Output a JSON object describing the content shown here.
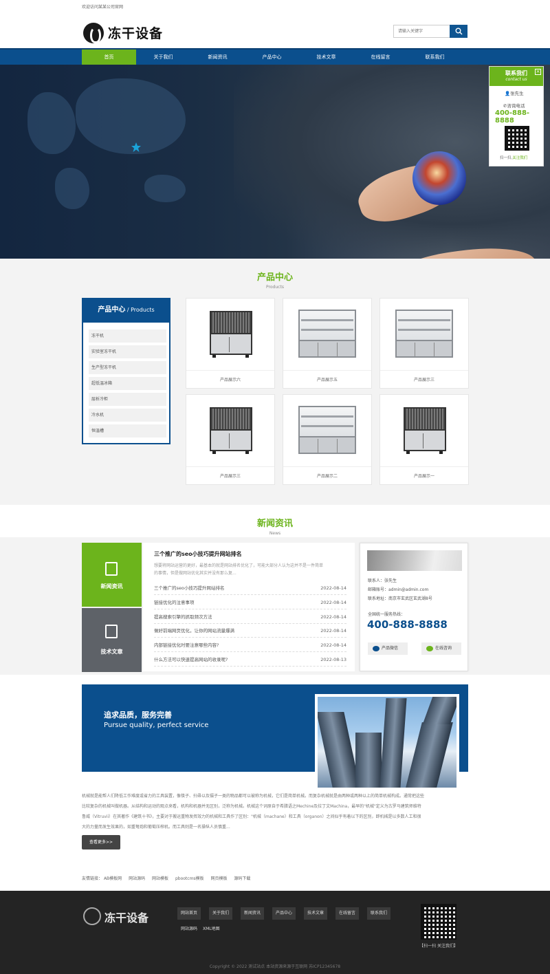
{
  "topbar": {
    "welcome": "欢迎访问某某公司官网"
  },
  "header": {
    "logo_text": "冻干设备",
    "search_placeholder": "请输入关键字"
  },
  "nav": {
    "items": [
      "首页",
      "关于我们",
      "新闻资讯",
      "产品中心",
      "技术文章",
      "在线留言",
      "联系我们"
    ],
    "active_index": 0
  },
  "float_contact": {
    "title": "联系我们",
    "subtitle": "contact us",
    "person": "张先生",
    "phone_label": "咨询电话",
    "phone": "400-888-8888",
    "scan_prefix": "扫一扫,",
    "scan_action": "关注我们"
  },
  "products": {
    "title": "产品中心",
    "title_en": "Products",
    "sidebar_title": "产品中心",
    "sidebar_title_en": " / Products",
    "categories": [
      "冻干机",
      "实验室冻干机",
      "生产型冻干机",
      "超低温冰箱",
      "层析冷柜",
      "冷水机",
      "恒温槽"
    ],
    "items": [
      "产品展示六",
      "产品展示五",
      "产品展示三",
      "产品展示三",
      "产品展示二",
      "产品展示一"
    ]
  },
  "news": {
    "title": "新闻资讯",
    "title_en": "News",
    "tabs": [
      "新闻资讯",
      "技术文章"
    ],
    "featured_title": "三个推广的seo小技巧提升网站排名",
    "featured_summary_1": "想要将网站运营的更好，最基本的就是网站排名优化了，可能大部分人认为这并不是一件简单",
    "featured_summary_2": "的事情，但是做网站优化其实并没有那么复...",
    "list": [
      {
        "title": "三个推广的seo小技巧提升网站排名",
        "date": "2022-08-14"
      },
      {
        "title": "链接优化的注意事项",
        "date": "2022-08-14"
      },
      {
        "title": "提高搜索引擎的抓取频次方法",
        "date": "2022-08-14"
      },
      {
        "title": "做好前端网页优化，让你的网站流量爆满",
        "date": "2022-08-14"
      },
      {
        "title": "内部链接优化时要注意哪些内容?",
        "date": "2022-08-14"
      },
      {
        "title": "什么方法可以快速提高网站的收录呢?",
        "date": "2022-08-13"
      }
    ]
  },
  "contact_card": {
    "contact": "联系人：张先生",
    "email": "邮箱账号：admin@admin.com",
    "address": "联系地址：南京市玄武区玄武湖8号",
    "hotline_label": "全国统一服务热线：",
    "hotline": "400-888-8888",
    "btn_wechat": "产品微信",
    "btn_consult": "在线咨询"
  },
  "about": {
    "headline_cn": "追求品质，服务完善",
    "headline_en": "Pursue quality, perfect service",
    "text_lines": [
      "机械就是能帮人们降低工作难度或省力的工具装置，像筷子、扫帚以及镊子一类的物品都可以被称为机械，它们是简单机械。而复杂机械就是由两种或两种以上的简单机械构成。通常把这些",
      "比较复杂的机械叫做机器。从结构和运动的观点来看，机构和机器并无区别，泛称为机械。机械这个词原自于希腊语之Mechine及拉丁文Machina，最早的\"机械\"定义为古罗马建筑师维特",
      "鲁威（Vitruvii）在其著作《建筑十书》，主要对于搬运重物发挥效力的机械和工具作了区别：\"机械（machane）和工具（organon）之间似乎有着以下的区别，即机械是以多数人工和很",
      "大的力量而发生效果的，如重弩炮和葡萄压榨机。而工具则是一名操纵人员慎重..."
    ],
    "more_btn": "查看更多>>"
  },
  "friend_links": {
    "label": "友情链接：",
    "items": [
      "AB模板网",
      "网站源码",
      "网站模板",
      "pbootcms模板",
      "网页模板",
      "源码下载"
    ]
  },
  "footer": {
    "logo_text": "冻干设备",
    "nav": [
      "网站首页",
      "关于我们",
      "新闻资讯",
      "产品中心",
      "技术文章",
      "在线留言",
      "联系我们",
      "网站源码",
      "XML地图"
    ],
    "qr_caption": "【扫一扫 关注我们】",
    "copyright": "Copyright © 2022 测试站点 本站资源来源于互联网 苏ICP12345678"
  },
  "colors": {
    "brand_blue": "#0b4f8d",
    "brand_green": "#6cb41c",
    "footer_bg": "#242424"
  }
}
